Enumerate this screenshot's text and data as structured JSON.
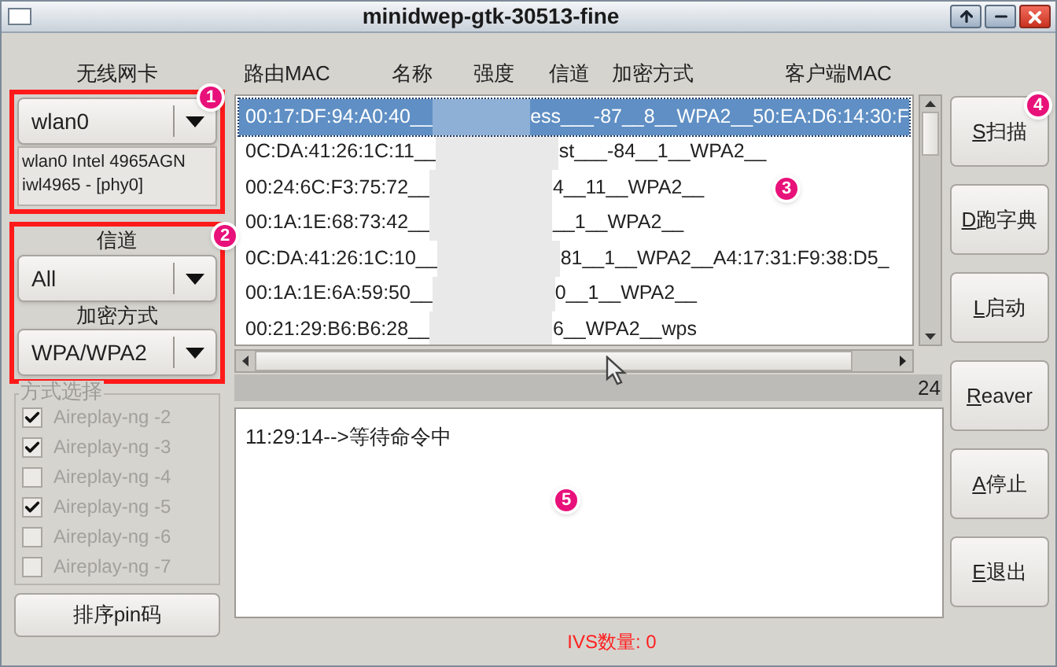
{
  "window": {
    "title": "minidwep-gtk-30513-fine"
  },
  "title_buttons": [
    {
      "kind": "maximize"
    },
    {
      "kind": "minimize"
    },
    {
      "kind": "close"
    }
  ],
  "wireless_card": {
    "label": "无线网卡",
    "value": "wlan0",
    "info": [
      "wlan0 Intel 4965AGN",
      "iwl4965 - [phy0]"
    ]
  },
  "channel": {
    "label": "信道",
    "value": "All"
  },
  "encryption": {
    "label": "加密方式",
    "value": "WPA/WPA2"
  },
  "mode_group": {
    "title": "方式选择",
    "disabled": true,
    "options": [
      {
        "label": "Aireplay-ng -2",
        "checked": true
      },
      {
        "label": "Aireplay-ng -3",
        "checked": true
      },
      {
        "label": "Aireplay-ng -4",
        "checked": false
      },
      {
        "label": "Aireplay-ng -5",
        "checked": true
      },
      {
        "label": "Aireplay-ng -6",
        "checked": false
      },
      {
        "label": "Aireplay-ng -7",
        "checked": false
      }
    ]
  },
  "sort_button": "排序pin码",
  "table": {
    "columns": [
      "路由MAC",
      "名称",
      "强度",
      "信道",
      "加密方式",
      "客户端MAC"
    ],
    "rows": [
      {
        "left": "00:17:DF:94:A0:40__",
        "right": "ess___-87__8__WPA2__50:EA:D6:14:30:F",
        "selected": true
      },
      {
        "left": "0C:DA:41:26:1C:11__",
        "right": "st___-84__1__WPA2__",
        "selected": false
      },
      {
        "left": "00:24:6C:F3:75:72__",
        "right": "4__11__WPA2__",
        "selected": false
      },
      {
        "left": "00:1A:1E:68:73:42__",
        "right": "__1__WPA2__",
        "selected": false
      },
      {
        "left": "0C:DA:41:26:1C:10__",
        "right": "81__1__WPA2__A4:17:31:F9:38:D5_",
        "selected": false
      },
      {
        "left": "00:1A:1E:6A:59:50__",
        "right": "0__1__WPA2__",
        "selected": false
      },
      {
        "left": "00:21:29:B6:B6:28__",
        "right": "6__WPA2__wps",
        "selected": false
      }
    ]
  },
  "count": "24",
  "log": [
    "11:29:14-->等待命令中"
  ],
  "buttons": [
    {
      "key": "S",
      "label": "扫描"
    },
    {
      "key": "D",
      "label": "跑字典"
    },
    {
      "key": "L",
      "label": "启动"
    },
    {
      "key": "R",
      "label": "eaver"
    },
    {
      "key": "A",
      "label": "停止"
    },
    {
      "key": "E",
      "label": "退出"
    }
  ],
  "status": "IVS数量: 0",
  "annotations": [
    "1",
    "2",
    "3",
    "4",
    "5"
  ]
}
